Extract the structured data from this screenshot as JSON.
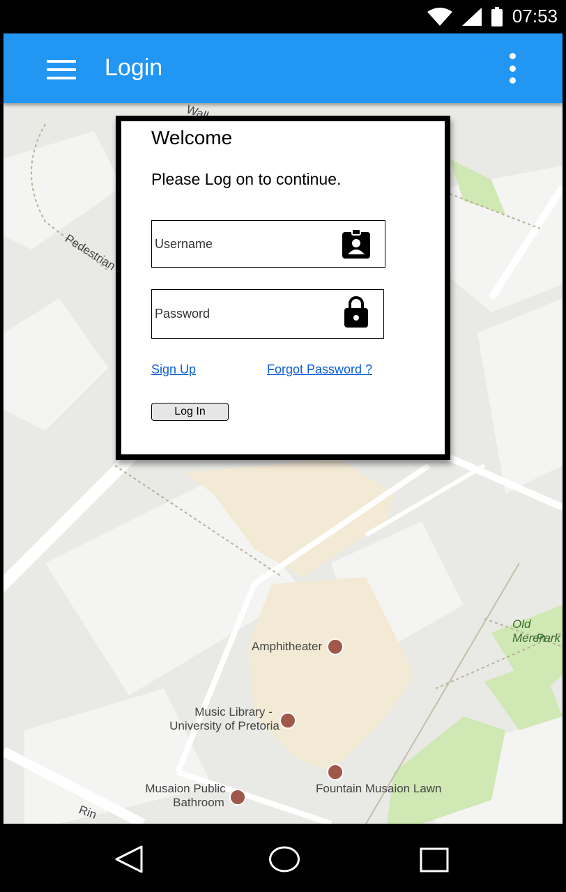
{
  "status_bar": {
    "time": "07:53"
  },
  "app_bar": {
    "title": "Login"
  },
  "dialog": {
    "welcome": "Welcome",
    "subtitle": "Please Log on to continue.",
    "username_placeholder": "Username",
    "password_placeholder": "Password",
    "sign_up": "Sign Up",
    "forgot_password": "Forgot Password ?",
    "login_button": "Log In"
  },
  "map": {
    "labels": {
      "street_top": "Wall",
      "pedestrian": "Pedestrian W",
      "amphitheater": "Amphitheater",
      "music_library_1": "Music Library -",
      "music_library_2": "University of Pretoria",
      "old_merensky_1": "Old Meren",
      "old_merensky_2": "Park",
      "fountain": "Fountain Musaion Lawn",
      "bathroom_1": "Musaion Public",
      "bathroom_2": "Bathroom",
      "street_bottom": "Rin"
    },
    "colors": {
      "base": "#e9e9e6",
      "building": "#f4f4f2",
      "campus": "#f3ead6",
      "park": "#cfe8b4",
      "road": "#ffffff",
      "poi": "#a0584b"
    }
  },
  "colors": {
    "app_bar": "#2196F3",
    "link": "#0b5ed7"
  }
}
